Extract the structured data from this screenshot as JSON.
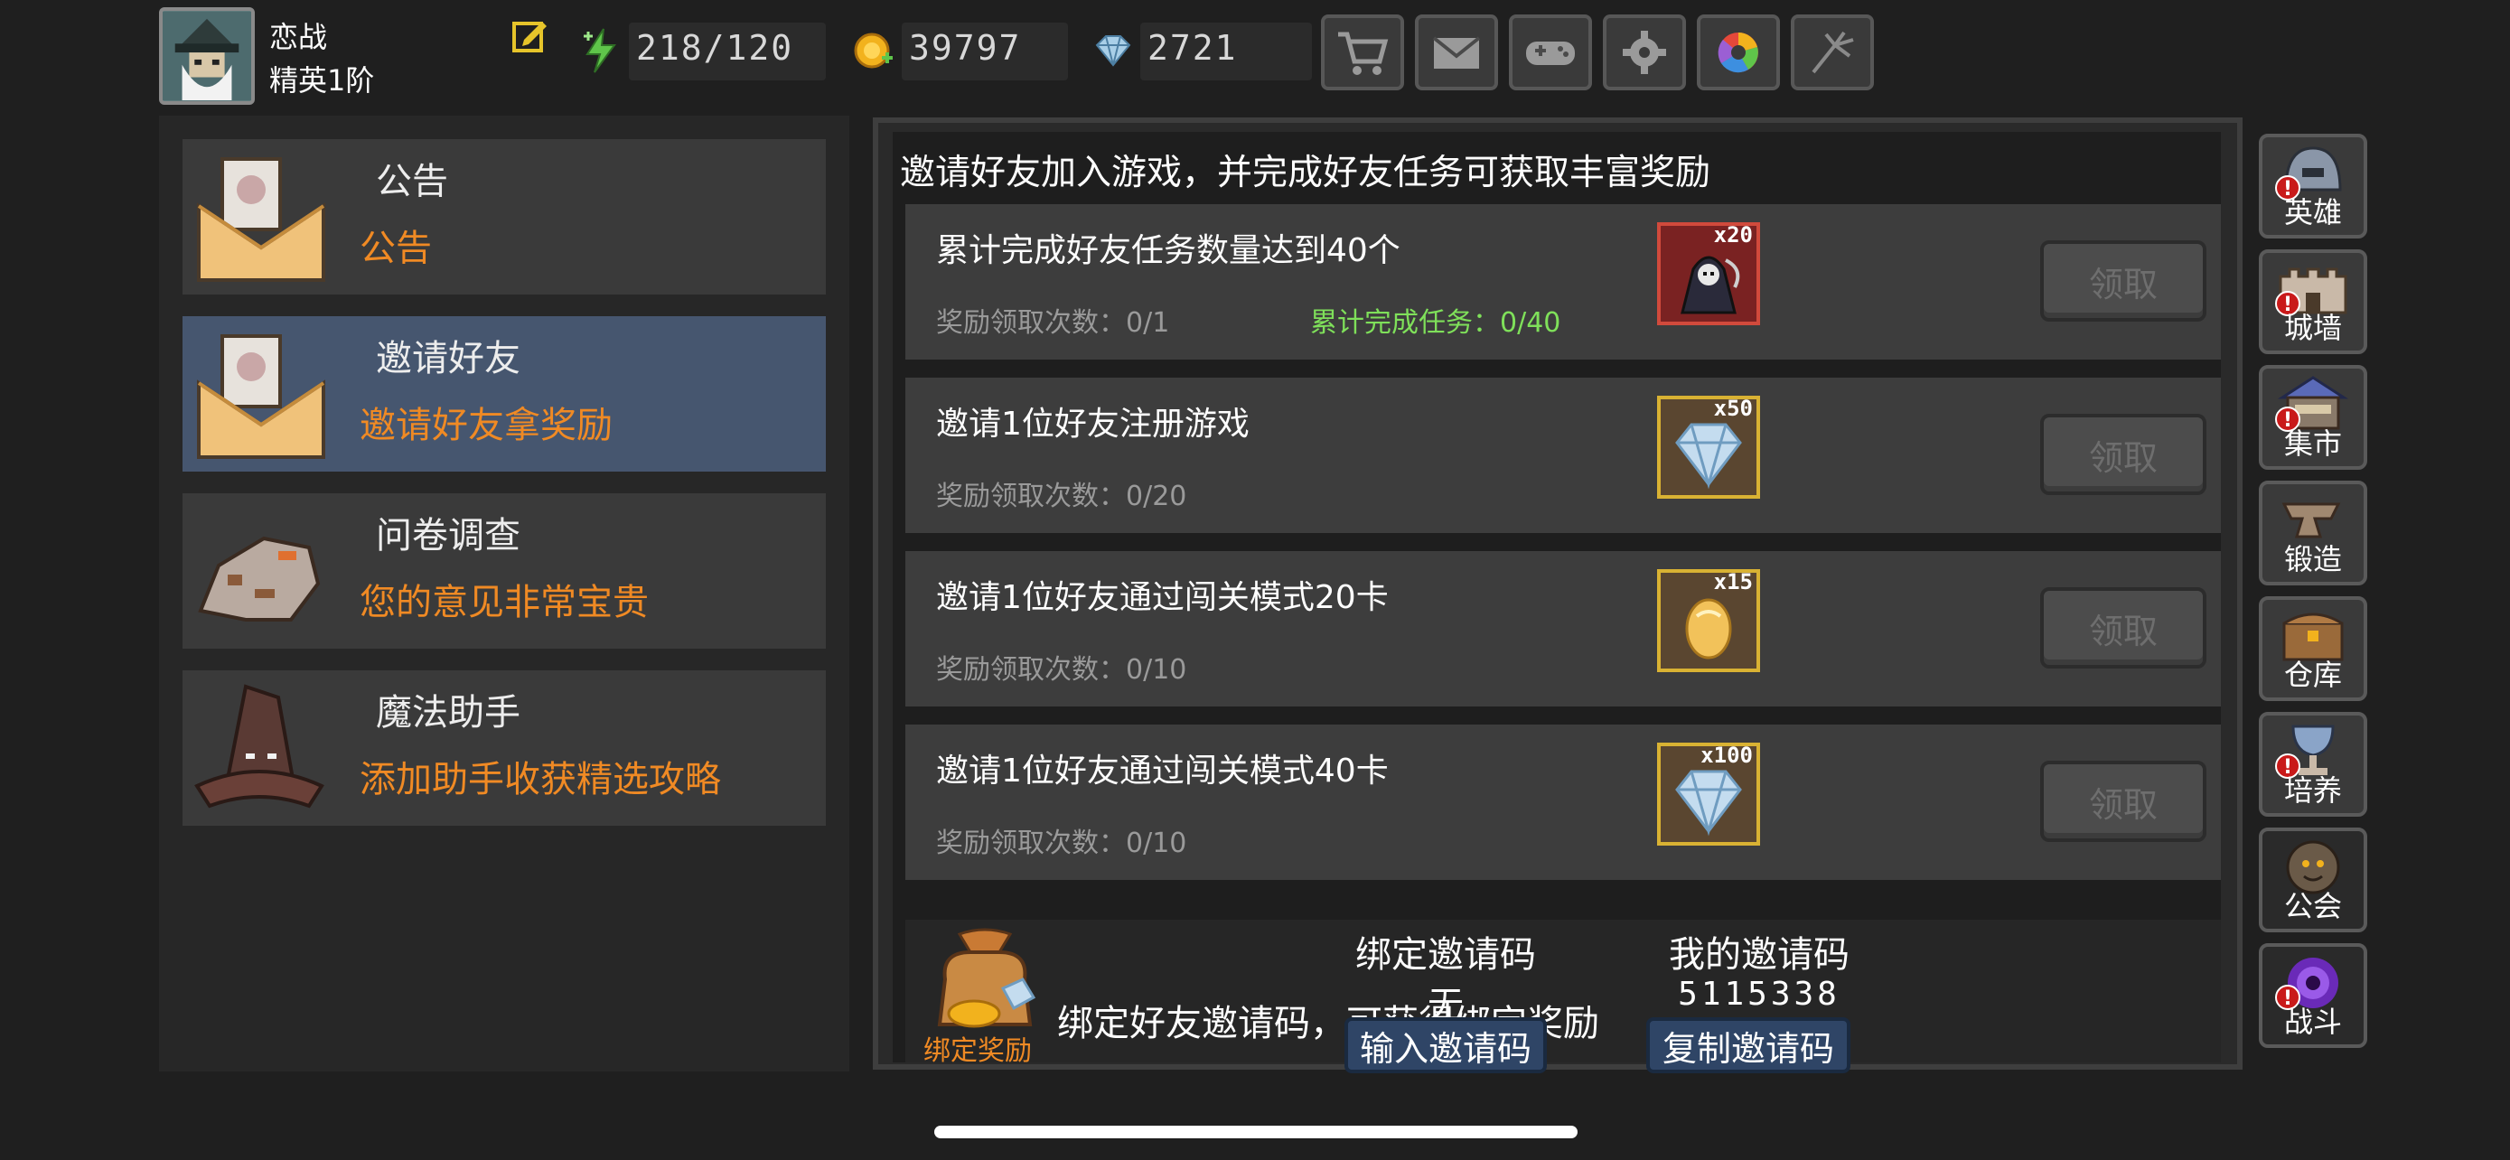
{
  "player": {
    "name": "恋战",
    "rank": "精英1阶"
  },
  "stats": {
    "energy": "218/120",
    "gold": "39797",
    "diamond": "2721"
  },
  "toolbar": [
    "cart-icon",
    "mail-icon",
    "gamepad-icon",
    "gear-icon",
    "color-wheel-icon",
    "fireworks-icon"
  ],
  "menu": [
    {
      "title": "公告",
      "subtitle": "公告",
      "active": false
    },
    {
      "title": "邀请好友",
      "subtitle": "邀请好友拿奖励",
      "active": true
    },
    {
      "title": "问卷调查",
      "subtitle": "您的意见非常宝贵",
      "active": false
    },
    {
      "title": "魔法助手",
      "subtitle": "添加助手收获精选攻略",
      "active": false
    }
  ],
  "invite": {
    "header": "邀请好友加入游戏，并完成好友任务可获取丰富奖励",
    "tasks": [
      {
        "title": "累计完成好友任务数量达到40个",
        "count": "奖励领取次数：0/1",
        "progress": "累计完成任务：0/40",
        "reward_qty": "x20",
        "reward_icon": "reaper-icon",
        "claim": "领取"
      },
      {
        "title": "邀请1位好友注册游戏",
        "count": "奖励领取次数：0/20",
        "progress": "",
        "reward_qty": "x50",
        "reward_icon": "diamond-icon",
        "claim": "领取"
      },
      {
        "title": "邀请1位好友通过闯关模式20卡",
        "count": "奖励领取次数：0/10",
        "progress": "",
        "reward_qty": "x15",
        "reward_icon": "egg-icon",
        "claim": "领取"
      },
      {
        "title": "邀请1位好友通过闯关模式40卡",
        "count": "奖励领取次数：0/10",
        "progress": "",
        "reward_qty": "x100",
        "reward_icon": "diamond-icon",
        "claim": "领取"
      }
    ],
    "bind": {
      "icon_label": "绑定奖励",
      "desc": "绑定好友邀请码，可获得绑定奖励",
      "bind_title": "绑定邀请码",
      "bind_value": "无",
      "bind_button": "输入邀请码",
      "my_title": "我的邀请码",
      "my_value": "5115338",
      "my_button": "复制邀请码"
    }
  },
  "sidebar": [
    {
      "label": "英雄",
      "badge": "!"
    },
    {
      "label": "城墙",
      "badge": "!"
    },
    {
      "label": "集市",
      "badge": "!"
    },
    {
      "label": "锻造",
      "badge": ""
    },
    {
      "label": "仓库",
      "badge": ""
    },
    {
      "label": "培养",
      "badge": "!"
    },
    {
      "label": "公会",
      "badge": ""
    },
    {
      "label": "战斗",
      "badge": "!"
    }
  ],
  "colors": {
    "accent_orange": "#f08a24",
    "progress_green": "#7fe05a",
    "active_menu": "#46566f",
    "badge_red": "#c91a1a"
  }
}
